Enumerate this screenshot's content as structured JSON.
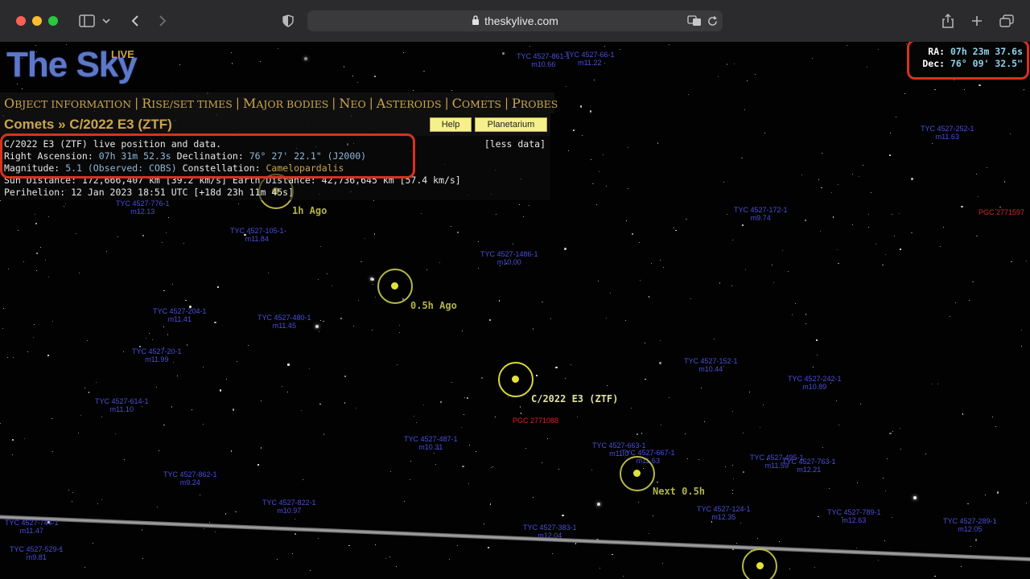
{
  "browser": {
    "url": "theskylive.com",
    "icons": [
      "sidebar-icon",
      "chevron-down-icon",
      "back-icon",
      "forward-icon",
      "shield-icon",
      "lock-icon",
      "translate-icon",
      "reload-icon",
      "share-icon",
      "new-tab-icon",
      "tabs-overview-icon"
    ]
  },
  "site": {
    "logo_text": "The Sky",
    "logo_sup": "LIVE"
  },
  "nav": {
    "items": [
      "Object Information",
      "Rise/Set Times",
      "Major Bodies",
      "NEO",
      "Asteroids",
      "Comets",
      "Probes"
    ],
    "separator": "|"
  },
  "breadcrumb": {
    "section": "Comets",
    "arrow": "»",
    "object": "C/2022 E3 (ZTF)",
    "help_label": "Help",
    "planetarium_label": "Planetarium"
  },
  "info": {
    "title": "C/2022 E3 (ZTF) live position and data.",
    "less_data": "[less data]",
    "ra_label": "Right Ascension:",
    "ra_value": "07h 31m 52.3s",
    "dec_label": "Declination:",
    "dec_value": "76° 27' 22.1\" (J2000)",
    "mag_label": "Magnitude:",
    "mag_value": "5.1 (Observed: COBS)",
    "const_label": "Constellation:",
    "const_value": "Camelopardalis",
    "sun_dist": "Sun Distance: 172,666,407 km [39.2 km/s] Earth Distance: 42,736,645 km [57.4 km/s]",
    "perihelion": "Perihelion: 12 Jan 2023 18:51 UTC [+18d 23h 11m 45s]"
  },
  "radec": {
    "ra_label": "RA:",
    "ra_value": "07h 23m 37.6s",
    "dec_label": "Dec:",
    "dec_value": "76° 09' 32.5\""
  },
  "map": {
    "positions": {
      "p1": "1h Ago",
      "p2": "0.5h Ago",
      "current": "C/2022 E3 (ZTF)",
      "next": "Next 0.5h"
    },
    "labels": [
      {
        "name": "TYC 4527-861-1",
        "mag": "m10.66"
      },
      {
        "name": "TYC 4527-66-1",
        "mag": "m11.22"
      },
      {
        "name": "TYC 4527-252-1",
        "mag": "m11.63"
      },
      {
        "name": "TYC 4527-776-1",
        "mag": "m12.13"
      },
      {
        "name": "TYC 4527-172-1",
        "mag": "m9.74"
      },
      {
        "name": "TYC 4527-105-1",
        "mag": "m11.84"
      },
      {
        "name": "TYC 4527-1486-1",
        "mag": "m10.00"
      },
      {
        "name": "TYC 4527-204-1",
        "mag": "m11.41"
      },
      {
        "name": "TYC 4527-480-1",
        "mag": "m11.45"
      },
      {
        "name": "TYC 4527-20-1",
        "mag": "m11.99"
      },
      {
        "name": "TYC 4527-152-1",
        "mag": "m10.44"
      },
      {
        "name": "TYC 4527-242-1",
        "mag": "m10.89"
      },
      {
        "name": "TYC 4527-614-1",
        "mag": "m11.10"
      },
      {
        "name": "TYC 4527-487-1",
        "mag": "m10.31"
      },
      {
        "name": "TYC 4527-663-1",
        "mag": "m11.0"
      },
      {
        "name": "TYC 4527-667-1",
        "mag": "m11.63"
      },
      {
        "name": "TYC 4527-862-1",
        "mag": "m9.24"
      },
      {
        "name": "TYC 4527-495-1",
        "mag": "m11.59"
      },
      {
        "name": "TYC 4527-763-1",
        "mag": "m12.21"
      },
      {
        "name": "TYC 4527-822-1",
        "mag": "m10.97"
      },
      {
        "name": "TYC 4527-124-1",
        "mag": "m12.35"
      },
      {
        "name": "TYC 4527-789-1",
        "mag": "m12.63"
      },
      {
        "name": "TYC 4527-289-1",
        "mag": "m12.05"
      },
      {
        "name": "TYC 4527-383-1",
        "mag": "m12.04"
      },
      {
        "name": "TYC 4527-744-1",
        "mag": "m11.47"
      },
      {
        "name": "TYC 4527-529-1",
        "mag": "m9.81"
      }
    ],
    "galaxies": [
      "PGC 2771597",
      "PGC 2771088"
    ]
  }
}
